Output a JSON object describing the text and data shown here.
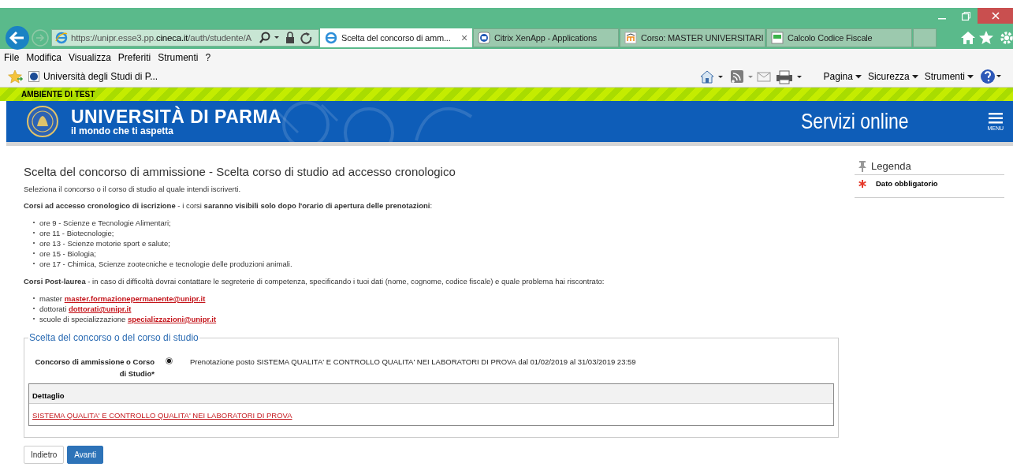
{
  "browser": {
    "address": {
      "prefix": "https://unipr.esse3.pp.",
      "domain": "cineca.it",
      "path": "/auth/studente/A"
    },
    "tabs": [
      {
        "title": "Scelta del concorso di amm...",
        "selected": true,
        "close": "×"
      },
      {
        "title": "Citrix XenApp - Applications",
        "selected": false
      },
      {
        "title": "Corso: MASTER UNIVERSITARI",
        "selected": false
      },
      {
        "title": "Calcolo Codice Fiscale",
        "selected": false
      }
    ],
    "menu": [
      "File",
      "Modifica",
      "Visualizza",
      "Preferiti",
      "Strumenti",
      "?"
    ],
    "favorite": "Università degli Studi di P...",
    "commands": [
      "Pagina",
      "Sicurezza",
      "Strumenti"
    ]
  },
  "page": {
    "test_banner": "AMBIENTE DI TEST",
    "header": {
      "title": "UNIVERSITÀ DI PARMA",
      "subtitle": "il mondo che ti aspetta",
      "service": "Servizi online",
      "menu_label": "MENU"
    },
    "heading": "Scelta del concorso di ammissione - Scelta corso di studio ad accesso cronologico",
    "intro": "Seleziona il concorso o il corso di studio al quale intendi iscriverti.",
    "chrono_note": "**Corsi ad accesso cronologico di iscrizione** - i corsi **saranno visibili solo dopo l'orario di apertura delle prenotazioni**:",
    "chrono_list": [
      "ore 9 - Scienze e Tecnologie Alimentari;",
      "ore 11 - Biotecnologie;",
      "ore 13 - Scienze motorie sport e salute;",
      "ore 15 - Biologia;",
      "ore 17 - Chimica, Scienze zootecniche e tecnologie delle produzioni animali."
    ],
    "postlaurea_note": "**Corsi Post-laurea** - in caso di difficoltà dovrai contattare le segreterie di competenza, specificando i tuoi dati (nome, cognome, codice fiscale) e quale problema hai riscontrato:",
    "contacts": [
      {
        "label": "master",
        "email": "master.formazionepermanente@unipr.it"
      },
      {
        "label": "dottorati",
        "email": "dottorati@unipr.it"
      },
      {
        "label": "scuole di specializzazione",
        "email": "specializzazioni@unipr.it"
      }
    ],
    "fieldset": {
      "legend": "Scelta del concorso o del corso di studio",
      "field_label": "Concorso di ammissione o Corso di Studio*",
      "options": [
        {
          "label": "Prenotazione posto SISTEMA QUALITA' E CONTROLLO QUALITA' NEI LABORATORI DI PROVA dal 01/02/2019 al 31/03/2019 23:59",
          "selected": true
        }
      ],
      "detail": {
        "header": "Dettaglio",
        "link": "SISTEMA QUALITA' E CONTROLLO QUALITA' NEI LABORATORI DI PROVA"
      }
    },
    "buttons": [
      {
        "label": "Indietro",
        "kind": "secondary"
      },
      {
        "label": "Avanti",
        "kind": "primary"
      }
    ],
    "legend": {
      "title": "Legenda",
      "items": [
        {
          "text": "Dato obbligatorio",
          "kind": "required"
        }
      ]
    }
  }
}
